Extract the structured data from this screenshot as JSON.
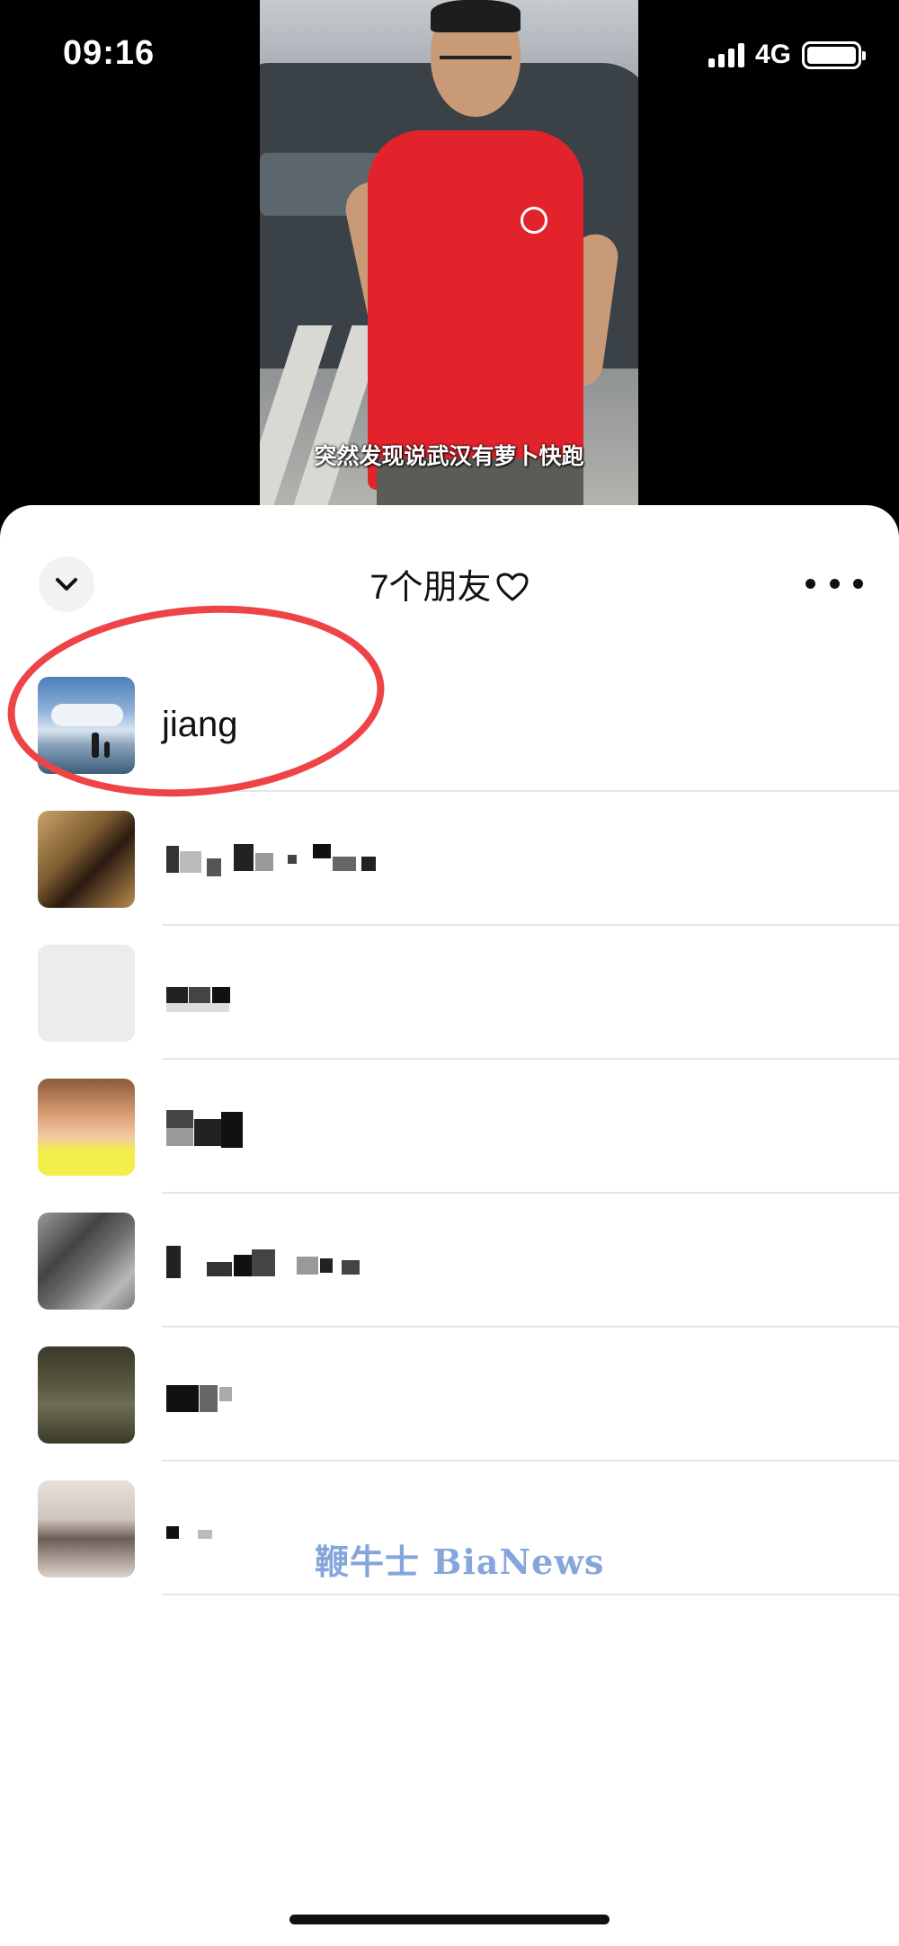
{
  "status_bar": {
    "time": "09:16",
    "network": "4G",
    "battery_level": 1.0
  },
  "video": {
    "caption": "突然发现说武汉有萝卜快跑"
  },
  "friends_sheet": {
    "title": "7个朋友",
    "collapse_icon": "chevron-down-icon",
    "title_icon": "heart-outline-icon",
    "more_icon": "more-horizontal-icon",
    "friends": [
      {
        "name": "jiang",
        "avatar": "sea-beach-avatar",
        "highlighted": true
      },
      {
        "name": "",
        "avatar": "blurred-avatar",
        "highlighted": false
      },
      {
        "name": "",
        "avatar": "blurred-avatar",
        "highlighted": false
      },
      {
        "name": "",
        "avatar": "blurred-avatar",
        "highlighted": false
      },
      {
        "name": "",
        "avatar": "blurred-avatar",
        "highlighted": false
      },
      {
        "name": "",
        "avatar": "blurred-avatar",
        "highlighted": false
      },
      {
        "name": "",
        "avatar": "blurred-avatar",
        "highlighted": false
      }
    ]
  },
  "watermark": "鞭牛士 BiaNews",
  "colors": {
    "annotation": "#ee4448",
    "watermark": "#86a6db",
    "divider": "#e6e6e6"
  }
}
